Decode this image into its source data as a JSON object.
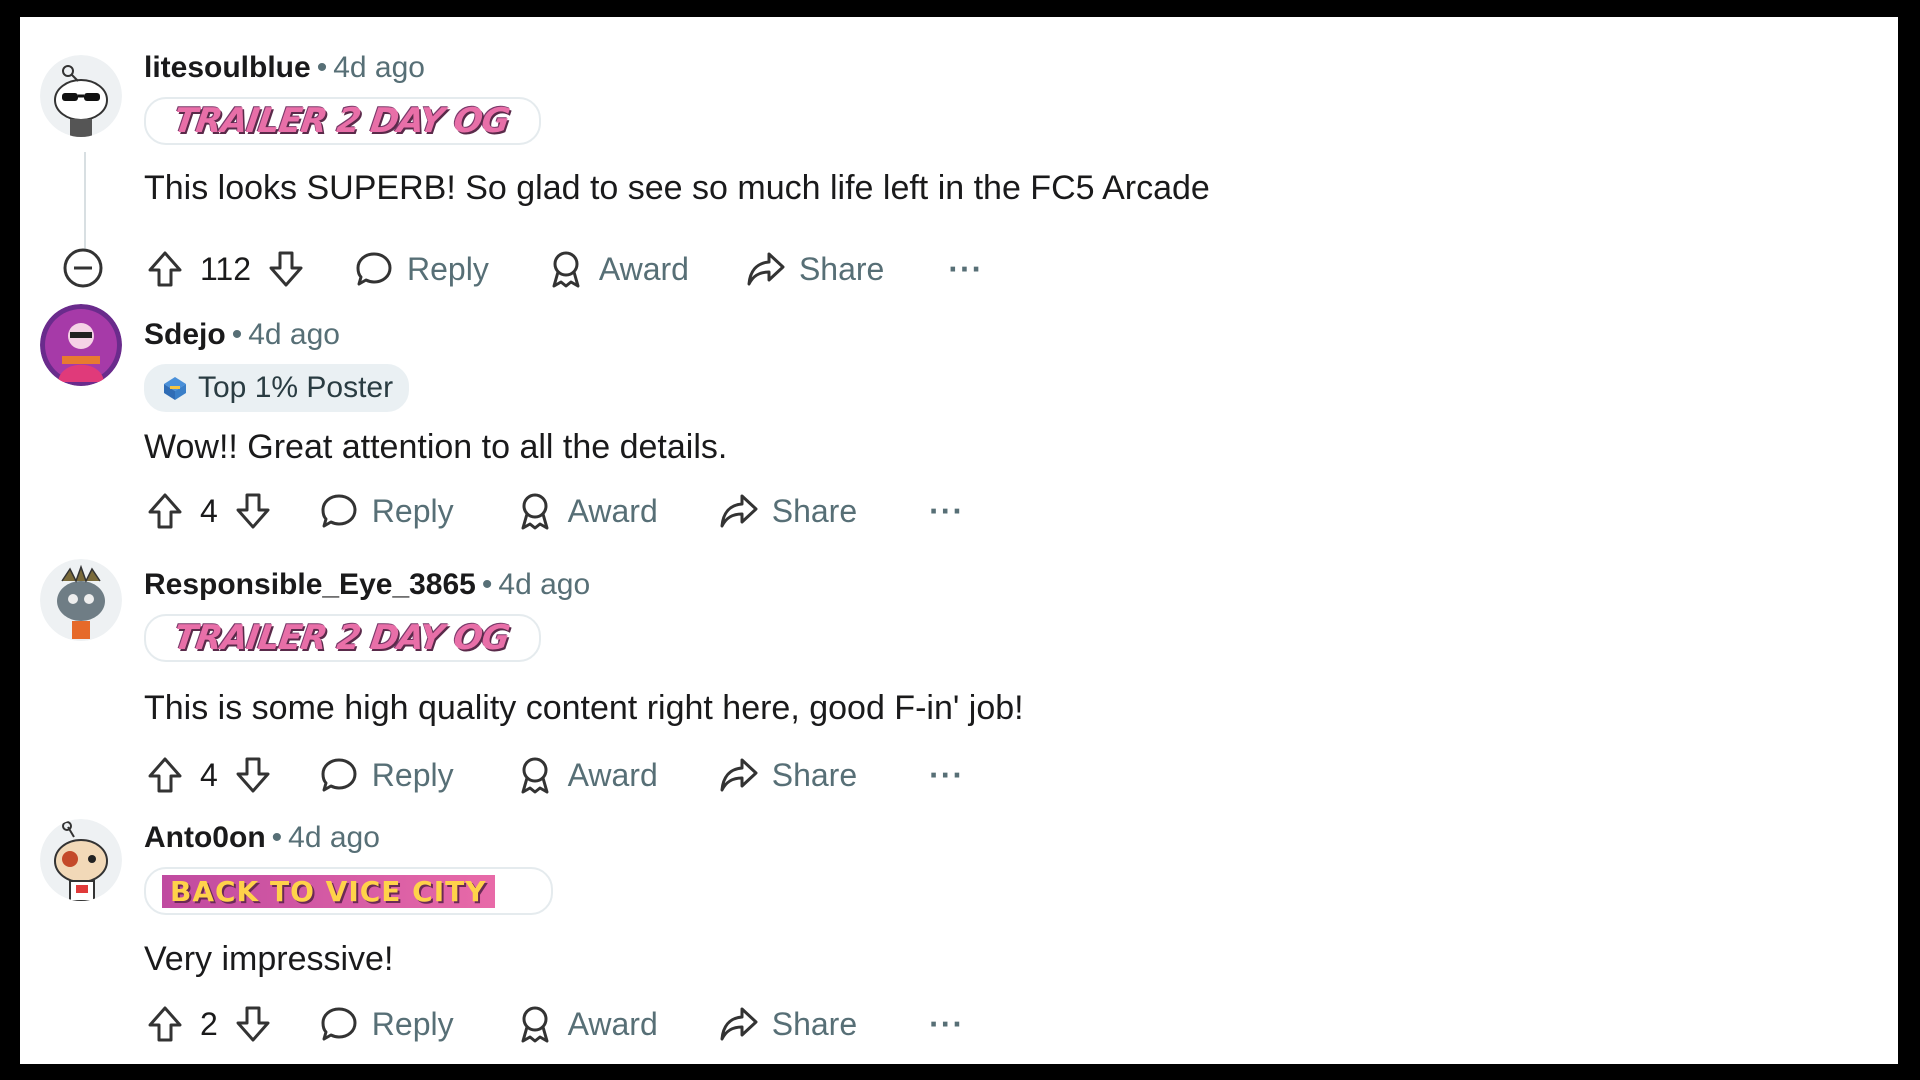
{
  "comments": [
    {
      "username": "litesoulblue",
      "time": "4d ago",
      "flair": "TRAILER 2 DAY OG",
      "body": "This looks SUPERB! So glad to see so much life left in the FC5 Arcade",
      "votes": "112",
      "reply": "Reply",
      "award": "Award",
      "share": "Share",
      "more": "···"
    },
    {
      "username": "Sdejo",
      "time": "4d ago",
      "flair": "Top 1% Poster",
      "body": "Wow!! Great attention to all the details.",
      "votes": "4",
      "reply": "Reply",
      "award": "Award",
      "share": "Share",
      "more": "···"
    },
    {
      "username": "Responsible_Eye_3865",
      "time": "4d ago",
      "flair": "TRAILER 2 DAY OG",
      "body": "This is some high quality content right here, good F-in' job!",
      "votes": "4",
      "reply": "Reply",
      "award": "Award",
      "share": "Share",
      "more": "···"
    },
    {
      "username": "Anto0on",
      "time": "4d ago",
      "flair": "BACK TO VICE CITY",
      "body": "Very impressive!",
      "votes": "2",
      "reply": "Reply",
      "award": "Award",
      "share": "Share",
      "more": "···"
    }
  ],
  "separator": "•",
  "colors": {
    "text": "#1a1a1b",
    "meta": "#576f76",
    "flair_pink": "#e86fa8"
  }
}
